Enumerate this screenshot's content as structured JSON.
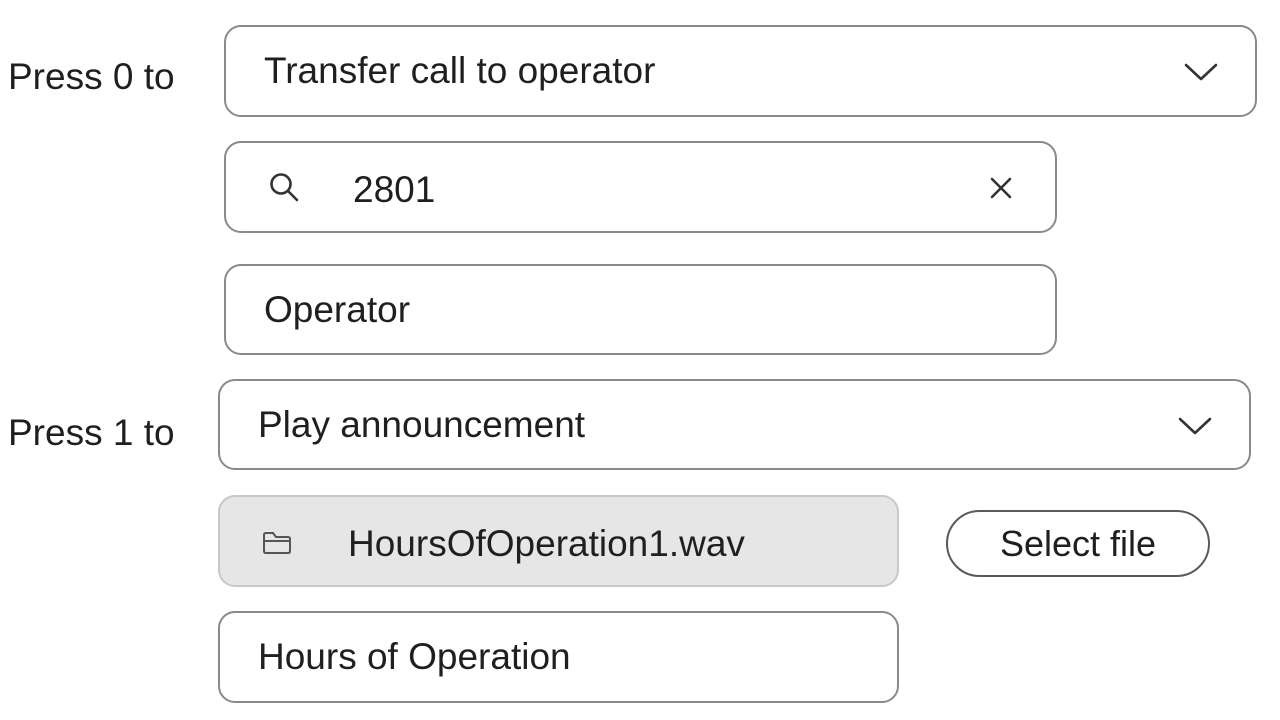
{
  "menu_options": [
    {
      "label": "Press 0 to",
      "action": "Transfer call to operator",
      "search_value": "2801",
      "name_value": "Operator"
    },
    {
      "label": "Press 1 to",
      "action": "Play announcement",
      "file_name": "HoursOfOperation1.wav",
      "select_file_label": "Select file",
      "name_value": "Hours of Operation"
    }
  ],
  "icons": {
    "dropdown": "chevron-down-icon",
    "search": "search-icon",
    "clear": "close-icon",
    "file": "folder-icon"
  }
}
